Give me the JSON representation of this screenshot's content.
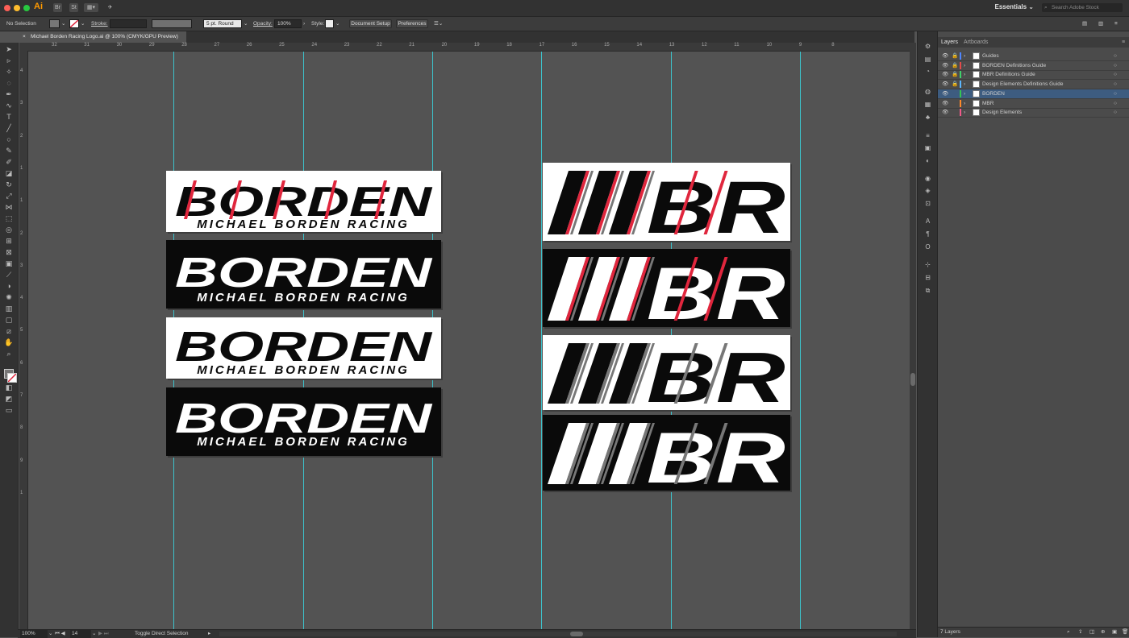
{
  "app": {
    "logo": "Ai",
    "workspace": "Essentials",
    "stock_search": "Search Adobe Stock",
    "bridge": "Br",
    "stock": "St"
  },
  "control_bar": {
    "selection": "No Selection",
    "stroke_label": "Stroke:",
    "brush": "5 pt. Round",
    "opacity_label": "Opacity:",
    "opacity_value": "100%",
    "style_label": "Style:",
    "document_setup": "Document Setup",
    "preferences": "Preferences"
  },
  "document": {
    "tab_title": "Michael Borden Racing Logo.ai @ 100% (CMYK/GPU Preview)",
    "close": "×"
  },
  "ruler": {
    "h_ticks": [
      "32",
      "31",
      "30",
      "29",
      "28",
      "27",
      "26",
      "25",
      "24",
      "23",
      "22",
      "21",
      "20",
      "19",
      "18",
      "17",
      "16",
      "15",
      "14",
      "13",
      "12",
      "11",
      "10",
      "9",
      "8"
    ],
    "v_ticks": [
      "4",
      "3",
      "2",
      "1",
      "1",
      "2",
      "3",
      "4",
      "5",
      "6",
      "7",
      "8",
      "9",
      "1"
    ]
  },
  "logos": {
    "borden_word": "BORDEN",
    "borden_sub": "MICHAEL BORDEN RACING",
    "mbr_word": "BR"
  },
  "colors": {
    "red": "#e0263d",
    "gray": "#777777",
    "black": "#0a0a0a",
    "white": "#ffffff",
    "guide": "#3ad6e0",
    "selected_layer": "#3d5c80"
  },
  "status": {
    "zoom": "100%",
    "artboard": "14",
    "tool_hint": "Toggle Direct Selection",
    "layer_count": "7 Layers"
  },
  "panel": {
    "tabs": [
      "Layers",
      "Artboards"
    ],
    "layers": [
      {
        "name": "Guides",
        "color": "#4f86ff"
      },
      {
        "name": "BORDEN Definitions Guide",
        "color": "#e34b4b"
      },
      {
        "name": "MBR Definitions Guide",
        "color": "#3fd06b"
      },
      {
        "name": "Design Elements Definitions Guide",
        "color": "#5bb7ff"
      },
      {
        "name": "BORDEN",
        "color": "#34c651"
      },
      {
        "name": "MBR",
        "color": "#ff8a2a"
      },
      {
        "name": "Design Elements",
        "color": "#f05a8a"
      }
    ]
  }
}
